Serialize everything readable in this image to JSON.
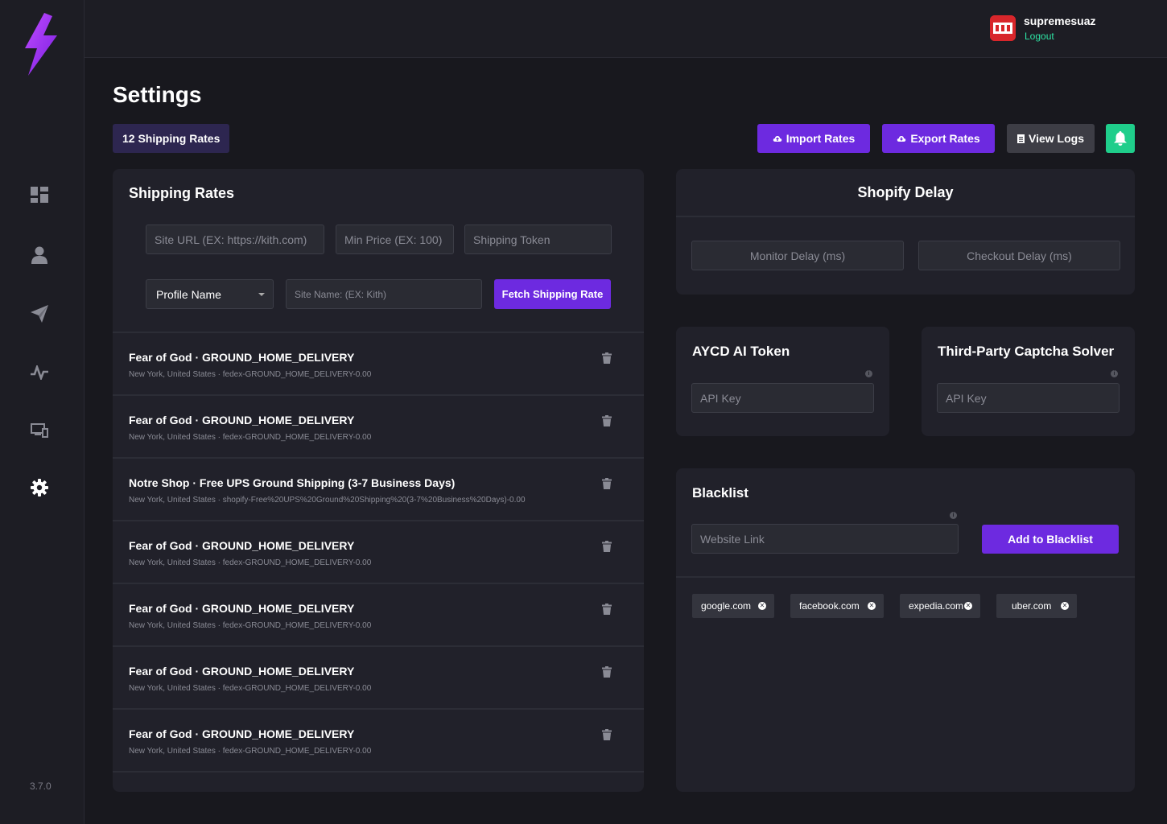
{
  "app": {
    "version": "3.7.0"
  },
  "sidebar": {
    "items": [
      {
        "icon": "dashboard-icon"
      },
      {
        "icon": "profile-icon"
      },
      {
        "icon": "send-icon"
      },
      {
        "icon": "activity-icon"
      },
      {
        "icon": "devices-icon"
      },
      {
        "icon": "gear-icon"
      }
    ]
  },
  "header": {
    "username": "supremesuaz",
    "logout_label": "Logout"
  },
  "page": {
    "title": "Settings",
    "rates_badge": "12 Shipping Rates"
  },
  "toolbar": {
    "import_label": "Import Rates",
    "export_label": "Export Rates",
    "logs_label": "View Logs"
  },
  "shipping": {
    "title": "Shipping Rates",
    "site_url_placeholder": "Site URL (EX: https://kith.com)",
    "min_price_placeholder": "Min Price (EX: 100)",
    "token_placeholder": "Shipping Token",
    "profile_select": "Profile Name",
    "site_name_placeholder": "Site Name: (EX: Kith)",
    "fetch_label": "Fetch Shipping Rate",
    "rates": [
      {
        "store": "Fear of God",
        "method": "GROUND_HOME_DELIVERY",
        "location": "New York, United States",
        "id": "fedex-GROUND_HOME_DELIVERY-0.00"
      },
      {
        "store": "Fear of God",
        "method": "GROUND_HOME_DELIVERY",
        "location": "New York, United States",
        "id": "fedex-GROUND_HOME_DELIVERY-0.00"
      },
      {
        "store": "Notre Shop",
        "method": "Free UPS Ground Shipping (3-7 Business Days)",
        "location": "New York, United States",
        "id": "shopify-Free%20UPS%20Ground%20Shipping%20(3-7%20Business%20Days)-0.00"
      },
      {
        "store": "Fear of God",
        "method": "GROUND_HOME_DELIVERY",
        "location": "New York, United States",
        "id": "fedex-GROUND_HOME_DELIVERY-0.00"
      },
      {
        "store": "Fear of God",
        "method": "GROUND_HOME_DELIVERY",
        "location": "New York, United States",
        "id": "fedex-GROUND_HOME_DELIVERY-0.00"
      },
      {
        "store": "Fear of God",
        "method": "GROUND_HOME_DELIVERY",
        "location": "New York, United States",
        "id": "fedex-GROUND_HOME_DELIVERY-0.00"
      },
      {
        "store": "Fear of God",
        "method": "GROUND_HOME_DELIVERY",
        "location": "New York, United States",
        "id": "fedex-GROUND_HOME_DELIVERY-0.00"
      }
    ]
  },
  "shopify_delay": {
    "title": "Shopify Delay",
    "monitor_placeholder": "Monitor Delay (ms)",
    "checkout_placeholder": "Checkout Delay (ms)"
  },
  "aycd": {
    "title": "AYCD AI Token",
    "api_placeholder": "API Key"
  },
  "captcha": {
    "title": "Third-Party Captcha Solver",
    "api_placeholder": "API Key"
  },
  "blacklist": {
    "title": "Blacklist",
    "link_placeholder": "Website Link",
    "add_label": "Add to Blacklist",
    "entries": [
      "google.com",
      "facebook.com",
      "expedia.com",
      "uber.com"
    ]
  },
  "colors": {
    "accent": "#6d2ae0",
    "success": "#1fce8b",
    "background": "#18181e",
    "card": "#21212a"
  }
}
